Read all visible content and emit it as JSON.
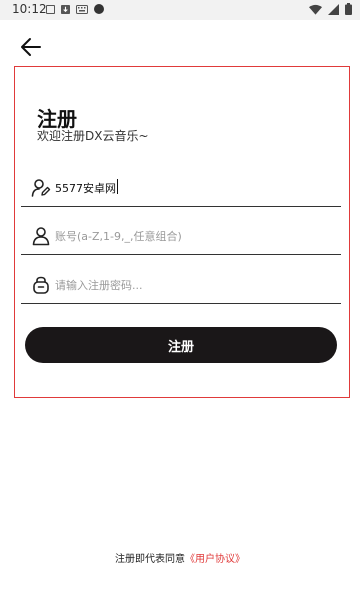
{
  "status_bar": {
    "time": "10:12"
  },
  "icons": {
    "back": "arrow-left-icon",
    "username": "user-edit-icon",
    "account": "person-icon",
    "password": "lock-icon"
  },
  "form": {
    "title": "注册",
    "subtitle": "欢迎注册DX云音乐~",
    "username": {
      "value": "5577安卓网"
    },
    "account": {
      "value": "",
      "placeholder": "账号(a-Z,1-9,_,任意组合)"
    },
    "password": {
      "value": "",
      "placeholder": "请输入注册密码..."
    },
    "submit_label": "注册"
  },
  "agreement": {
    "prefix": "注册即代表同意",
    "link": "《用户协议》"
  },
  "colors": {
    "accent_red": "#e03a3a",
    "button_dark": "#1a1718"
  }
}
